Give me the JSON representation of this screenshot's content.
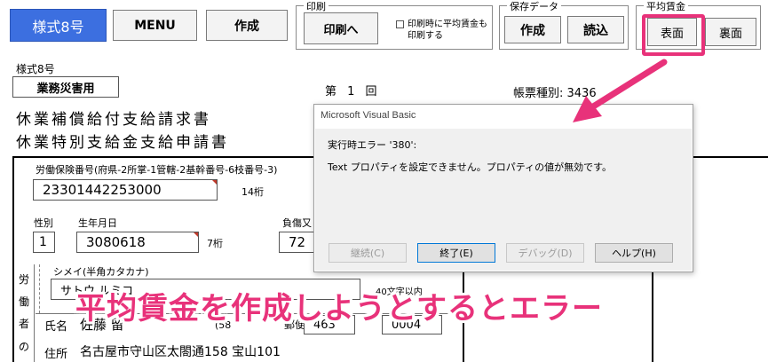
{
  "toolbar": {
    "form8_label": "様式8号",
    "menu_label": "MENU",
    "create_label": "作成"
  },
  "print_group": {
    "title": "印刷",
    "print_label": "印刷へ",
    "checkbox_label": "印刷時に平均賃金も印刷する",
    "checkbox_checked": false
  },
  "save_group": {
    "title": "保存データ",
    "create_label": "作成",
    "load_label": "読込"
  },
  "avg_group": {
    "title": "平均賃金",
    "front_label": "表面",
    "back_label": "裏面"
  },
  "form": {
    "sheet_name": "様式8号",
    "category": "業務災害用",
    "title_line1": "休業補償給付支給請求書",
    "title_line2": "休業特別支給金支給申請書",
    "issue_label": "第 1 回",
    "doc_type": "帳票種別: 3436",
    "insurance_label": "労働保険番号(府県-2所掌-1管轄-2基幹番号-6枝番号-3)",
    "insurance_number": "23301442253000",
    "insurance_digits": "14桁",
    "gender_label": "性別",
    "gender_value": "1",
    "birth_label": "生年月日",
    "birth_value": "3080618",
    "birth_digits": "7桁",
    "injury_label": "負傷又",
    "injury_value": "72",
    "worker_chars": [
      "労",
      "働",
      "者",
      "の"
    ],
    "kana_label": "シメイ(半角カタカナ)",
    "kana_value": "サトウ ルミコ",
    "within_label": "40文字以内",
    "name_label": "氏名",
    "name_value": "佐藤 留",
    "age_value": "(58",
    "postal_label": "郵便",
    "postal1": "463",
    "postal2": "0004",
    "address_label": "住所",
    "address_value": "名古屋市守山区太閤通158 宝山101"
  },
  "dialog": {
    "title": "Microsoft Visual Basic",
    "message1": "実行時エラー '380':",
    "message2": "Text プロパティを設定できません。プロパティの値が無効です。",
    "buttons": [
      {
        "label": "継続(C)",
        "enabled": false
      },
      {
        "label": "終了(E)",
        "enabled": true
      },
      {
        "label": "デバッグ(D)",
        "enabled": false
      },
      {
        "label": "ヘルプ(H)",
        "enabled": true
      }
    ]
  },
  "annotation": {
    "caption": "平均賃金を作成しようとするとエラー",
    "color": "#e8327a"
  },
  "colors": {
    "primary_button": "#3c6fe0",
    "highlight": "#e8327a"
  }
}
